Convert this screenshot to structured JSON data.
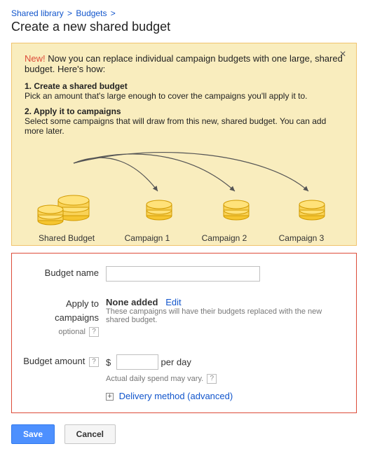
{
  "breadcrumb": {
    "shared_library": "Shared library",
    "budgets": "Budgets"
  },
  "title": "Create a new shared budget",
  "info": {
    "new_label": "New!",
    "intro": " Now you can replace individual campaign budgets with one large, shared budget. Here's how:",
    "step1_title": "1. Create a shared budget",
    "step1_body": "Pick an amount that's large enough to cover the campaigns you'll apply it to.",
    "step2_title": "2. Apply it to campaigns",
    "step2_body": "Select some campaigns that will draw from this new, shared budget. You can add more later.",
    "labels": {
      "shared": "Shared Budget",
      "c1": "Campaign 1",
      "c2": "Campaign 2",
      "c3": "Campaign 3"
    }
  },
  "form": {
    "name_label": "Budget name",
    "apply_label": "Apply to campaigns",
    "optional": "optional",
    "none_added": "None added",
    "edit": "Edit",
    "apply_desc": "These campaigns will have their budgets replaced with the new shared budget.",
    "amount_label": "Budget amount",
    "currency": "$",
    "per_day": "per day",
    "spend_note": "Actual daily spend may vary.",
    "delivery": "Delivery method (advanced)"
  },
  "buttons": {
    "save": "Save",
    "cancel": "Cancel"
  }
}
